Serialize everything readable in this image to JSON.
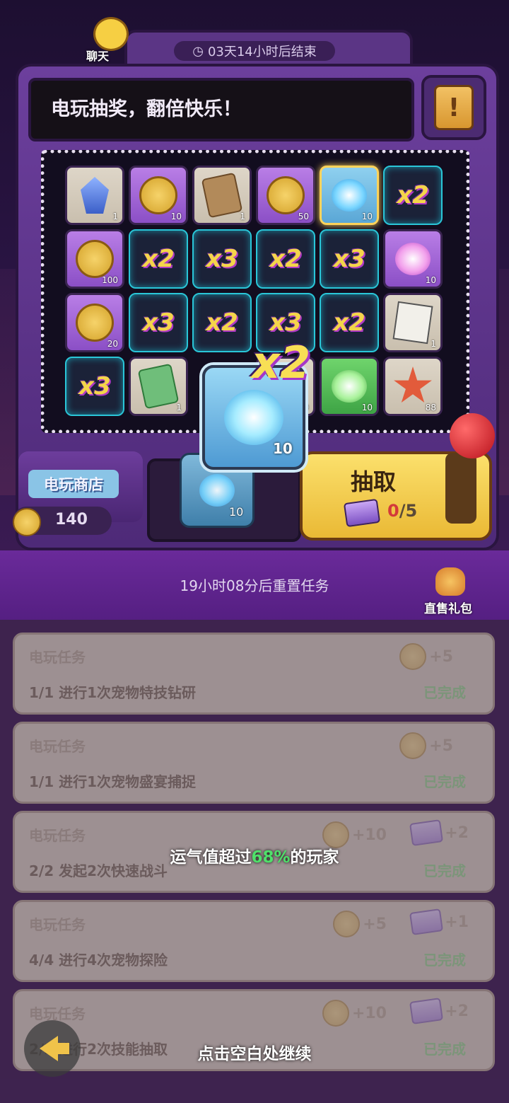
{
  "header": {
    "chat_label": "聊天",
    "timer_text": "03天14小时后结束",
    "marquee_text": "电玩抽奖，翻倍快乐！",
    "help_icon": "exclamation-scroll-icon"
  },
  "board": {
    "cells": [
      {
        "kind": "item",
        "icon": "crystal-icon",
        "count": "1",
        "style": "common"
      },
      {
        "kind": "item",
        "icon": "coin-icon",
        "count": "10",
        "style": "rare"
      },
      {
        "kind": "item",
        "icon": "ticket-icon",
        "count": "1",
        "style": "common"
      },
      {
        "kind": "item",
        "icon": "coin-icon",
        "count": "50",
        "style": "rare"
      },
      {
        "kind": "item",
        "icon": "blue-orb-icon",
        "count": "10",
        "style": "blue"
      },
      {
        "kind": "mult",
        "label": "x2"
      },
      {
        "kind": "item",
        "icon": "coin-icon",
        "count": "100",
        "style": "rare"
      },
      {
        "kind": "mult",
        "label": "x2"
      },
      {
        "kind": "mult",
        "label": "x3"
      },
      {
        "kind": "mult",
        "label": "x2"
      },
      {
        "kind": "mult",
        "label": "x3"
      },
      {
        "kind": "item",
        "icon": "pink-orb-icon",
        "count": "10",
        "style": "rare"
      },
      {
        "kind": "item",
        "icon": "coin-icon",
        "count": "20",
        "style": "rare"
      },
      {
        "kind": "mult",
        "label": "x3"
      },
      {
        "kind": "mult",
        "label": "x2"
      },
      {
        "kind": "mult",
        "label": "x3"
      },
      {
        "kind": "mult",
        "label": "x2"
      },
      {
        "kind": "item",
        "icon": "paper-icon",
        "count": "1",
        "style": "common"
      },
      {
        "kind": "mult",
        "label": "x3"
      },
      {
        "kind": "item",
        "icon": "green-ticket-icon",
        "count": "1",
        "style": "common"
      },
      {
        "kind": "empty"
      },
      {
        "kind": "item",
        "icon": "blue-orb-icon",
        "count": "50",
        "style": "common"
      },
      {
        "kind": "item",
        "icon": "green-orb-icon",
        "count": "10",
        "style": "green"
      },
      {
        "kind": "item",
        "icon": "starfish-icon",
        "count": "88",
        "style": "common"
      }
    ]
  },
  "reward_popup": {
    "multiplier": "x2",
    "count": "10"
  },
  "shop": {
    "label": "电玩商店",
    "coins": "140"
  },
  "slot": {
    "count": "10"
  },
  "draw": {
    "label": "抽取",
    "current": "0",
    "total": "/5"
  },
  "band": {
    "reset_text": "19小时08分后重置任务",
    "gift_label": "直售礼包"
  },
  "tasks": [
    {
      "title": "电玩任务",
      "desc": "1/1  进行1次宠物特技钻研",
      "status": "已完成",
      "coin": "+5",
      "ticket": ""
    },
    {
      "title": "电玩任务",
      "desc": "1/1  进行1次宠物盛宴捕捉",
      "status": "已完成",
      "coin": "+5",
      "ticket": ""
    },
    {
      "title": "电玩任务",
      "desc": "2/2  发起2次快速战斗",
      "status": "已完成",
      "coin": "+10",
      "ticket": "+2"
    },
    {
      "title": "电玩任务",
      "desc": "4/4  进行4次宠物探险",
      "status": "已完成",
      "coin": "+5",
      "ticket": "+1"
    },
    {
      "title": "电玩任务",
      "desc": "2/2  进行2次技能抽取",
      "status": "已完成",
      "coin": "+10",
      "ticket": "+2"
    }
  ],
  "overlay": {
    "luck_prefix": "运气值超过",
    "luck_pct": "68%",
    "luck_suffix": "的玩家",
    "continue_text": "点击空白处继续"
  },
  "colors": {
    "accent_gold": "#f4d54a",
    "luck_green": "#4fe06a",
    "cabinet_purple": "#6c3f9d"
  }
}
